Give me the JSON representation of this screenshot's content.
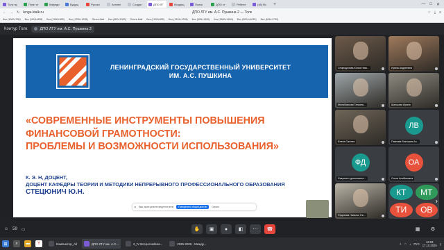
{
  "browser": {
    "tabs": [
      {
        "label": "Толк пр",
        "color": "#7b5cd6"
      },
      {
        "label": "План ст",
        "color": "#2e9e4f"
      },
      {
        "label": "Кафедр",
        "color": "#2e9e4f"
      },
      {
        "label": "Будущ",
        "color": "#4a79d6"
      },
      {
        "label": "Русски",
        "color": "#e5453d"
      },
      {
        "label": "Активн",
        "color": "#c0c4cc"
      },
      {
        "label": "Создан",
        "color": "#c0c4cc"
      },
      {
        "label": "ДПО ЛГ",
        "color": "#7b5cd6",
        "active": true
      },
      {
        "label": "Входящ",
        "color": "#e5453d"
      },
      {
        "label": "Поиск",
        "color": "#7b5cd6"
      },
      {
        "label": "ДПО ст",
        "color": "#2e9e4f"
      },
      {
        "label": "Ребене",
        "color": "#c0c4cc"
      },
      {
        "label": "(46) Вх",
        "color": "#7b5cd6"
      }
    ],
    "new_tab": "+",
    "url": "lengu.ktalk.ru",
    "page_title": "ДПО ЛГУ им. А.С. Пушкина 2 — Толк",
    "bookmarks": [
      "Бес (1000×750)",
      "Бес (1024×838)",
      "Бес (1280×800)",
      "Бес (1750×1238)",
      "Почта Mail",
      "Бес (800×1000)",
      "Почта Mail",
      "Бес (1200×800)",
      "Бес (1315×1205)",
      "Бес (995×1399)",
      "Бес (1600×1564)",
      "Бес (3024×4032)",
      "Бес (626×1792)"
    ]
  },
  "tolk": {
    "app_name": "Контур Толк",
    "room_name": "ДПО ЛГУ им. А.С. Пушкина 2"
  },
  "slide": {
    "university": [
      "ЛЕНИНГРАДСКИЙ ГОСУДАРСТВЕННЫЙ  УНИВЕРСИТЕТ",
      "ИМ. А.С. ПУШКИНА"
    ],
    "title": [
      "«СОВРЕМЕННЫЕ ИНСТРУМЕНТЫ ПОВЫШЕНИЯ",
      "ФИНАНСОВОЙ ГРАМОТНОСТИ:",
      "ПРОБЛЕМЫ И ВОЗМОЖНОСТИ ИСПОЛЬЗОВАНИЯ»"
    ],
    "author": [
      "К. Э. Н, ДОЦЕНТ,",
      "ДОЦЕНТ КАФЕДРЫ ТЕОРИИ И МЕТОДИКИ НЕПРЕРЫВНОГО ПРОФЕССИОНАЛЬНОГО ОБРАЗОВАНИЯ"
    ],
    "author_name": "СТЕЦЮНИЧ Ю.Н.",
    "banner_color": "#1663ae",
    "title_color": "#e8602c",
    "author_color": "#20438f"
  },
  "screenshare_bar": {
    "text": "Ваш экран демонстрируется всем",
    "stop_label": "Прекратить общий доступ",
    "hide_label": "Скрыть"
  },
  "participants": [
    {
      "name": "Спиридонова Юлия Нико...",
      "kind": "video",
      "bg": "#6d5a4a"
    },
    {
      "name": "Ирина Андреевна",
      "kind": "video",
      "bg": "#a07a5c"
    },
    {
      "name": "Желябовская Татьяна...",
      "kind": "video",
      "bg": "#9ea6a8"
    },
    {
      "name": "Шипшова Ирина",
      "kind": "video",
      "bg": "#8c8a80"
    },
    {
      "name": "Елена Салова",
      "kind": "video",
      "bg": "#6f6558"
    },
    {
      "name": "Павлова Виктория Ал...",
      "kind": "avatar",
      "initials": "ЛВ",
      "color": "#1a9a8e"
    },
    {
      "name": "Факультет дополнител...",
      "kind": "avatar",
      "initials": "ФД",
      "color": "#1a9a8e"
    },
    {
      "name": "Ольга Альбиновна",
      "kind": "avatar",
      "initials": "ОА",
      "color": "#e8523c"
    },
    {
      "name": "Федотова Наталья Ни...",
      "kind": "video",
      "bg": "#b9b3a6"
    },
    {
      "name": "",
      "kind": "more",
      "initials": [
        "КТ",
        "МТ",
        "ТИ",
        "ОВ"
      ],
      "colors": [
        "#1a9a8e",
        "#2f9a5a",
        "#e8523c",
        "#e8523c"
      ]
    }
  ],
  "controls": {
    "participants_count": "59"
  },
  "taskbar": {
    "items": [
      {
        "label": "Компьютер_All",
        "active": false
      },
      {
        "label": "ДПО ЛГУ им. А.С...",
        "active": true
      },
      {
        "label": "2_IV Всероссийска...",
        "active": false
      },
      {
        "label": "2025-2026 - Между...",
        "active": false
      }
    ],
    "lang": "РУС",
    "time": "12:03",
    "date": "17.10.2025"
  }
}
